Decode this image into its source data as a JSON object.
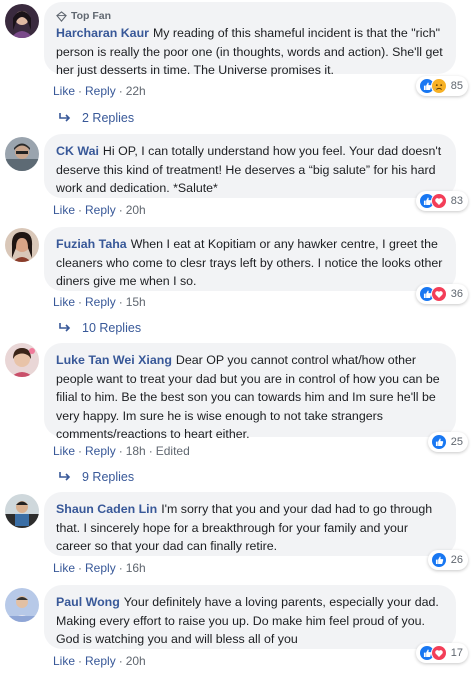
{
  "badge": {
    "top_fan": "Top Fan"
  },
  "comments": [
    {
      "author": "Harcharan Kaur",
      "text": "My reading of this shameful incident is that the \"rich\" person is really the poor one (in thoughts, words and action). She'll get her just desserts in time. The Universe promises it.",
      "like": "Like",
      "reply": "Reply",
      "time": "22h",
      "edited": "",
      "reaction_count": "85",
      "reactions": [
        "like-icon",
        "sad-icon"
      ],
      "replies": "2 Replies"
    },
    {
      "author": "CK Wai",
      "text": "Hi OP, I can totally understand how you feel. Your dad doesn't deserve this kind of treatment! He deserves a “big salute” for his hard work and dedication. *Salute*",
      "like": "Like",
      "reply": "Reply",
      "time": "20h",
      "edited": "",
      "reaction_count": "83",
      "reactions": [
        "like-icon",
        "love-icon"
      ],
      "replies": ""
    },
    {
      "author": "Fuziah Taha",
      "text": "When I eat at Kopitiam or any hawker centre, I greet the cleaners who come to clesr trays left by others. I notice the looks other diners give me when I so.",
      "like": "Like",
      "reply": "Reply",
      "time": "15h",
      "edited": "",
      "reaction_count": "36",
      "reactions": [
        "like-icon",
        "love-icon"
      ],
      "replies": "10 Replies"
    },
    {
      "author": "Luke Tan Wei Xiang",
      "text": "Dear OP you cannot control what/how other people want to treat your dad but you are in control of how you can be filial to him. Be the best son you can towards him and Im sure he'll be very happy. Im sure he is wise enough to not take strangers comments/reactions to heart either.",
      "like": "Like",
      "reply": "Reply",
      "time": "18h",
      "edited": "Edited",
      "reaction_count": "25",
      "reactions": [
        "like-icon"
      ],
      "replies": "9 Replies"
    },
    {
      "author": "Shaun Caden Lin",
      "text": "I'm sorry that you and your dad had to go through that. I sincerely hope for a breakthrough for your family and your career so that your dad can finally retire.",
      "like": "Like",
      "reply": "Reply",
      "time": "16h",
      "edited": "",
      "reaction_count": "26",
      "reactions": [
        "like-icon"
      ],
      "replies": ""
    },
    {
      "author": "Paul Wong",
      "text": "Your definitely have a loving parents, especially your dad. Making every effort to raise you up. Do make him feel proud of you. God is watching you and will bless all of you",
      "like": "Like",
      "reply": "Reply",
      "time": "20h",
      "edited": "",
      "reaction_count": "17",
      "reactions": [
        "like-icon",
        "love-icon"
      ],
      "replies": ""
    }
  ],
  "colors": {
    "link": "#385898",
    "meta": "#606770",
    "bubble": "#f2f3f5",
    "like": "#1877f2",
    "love": "#f33e58",
    "sad": "#f7b125"
  }
}
